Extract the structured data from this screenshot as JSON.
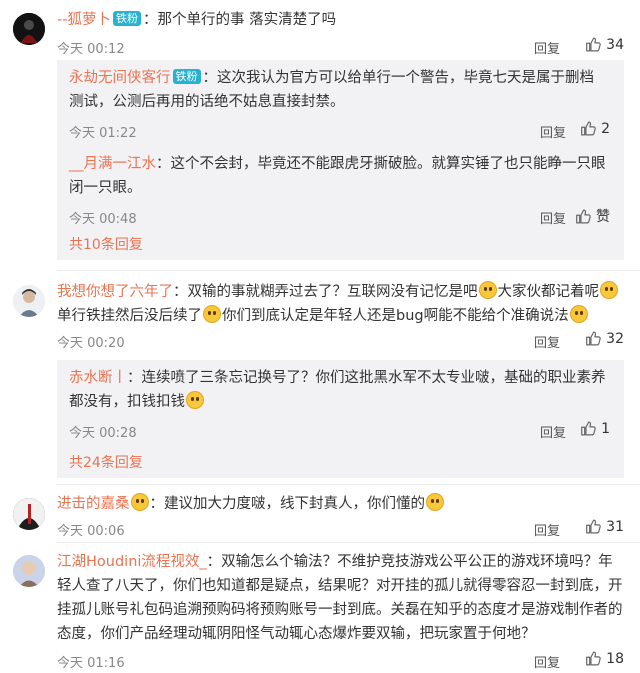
{
  "comments": [
    {
      "user": "--狐萝卜",
      "badge": "铁粉",
      "text": "：那个单行的事 落实清楚了吗",
      "time": "今天 00:12",
      "reply": "回复",
      "likes": "34",
      "replies": [
        {
          "user": "永劫无间侠客行",
          "badge": "铁粉",
          "text": "：这次我认为官方可以给单行一个警告，毕竟七天是属于删档测试，公测后再用的话绝不姑息直接封禁。",
          "time": "今天 01:22",
          "reply": "回复",
          "likes": "2"
        },
        {
          "user": "__月满一江水",
          "text": "：这个不会封，毕竟还不能跟虎牙撕破脸。就算实锤了也只能睁一只眼闭一只眼。",
          "time": "今天 00:48",
          "reply": "回复",
          "likes": "赞"
        }
      ],
      "more": "共10条回复"
    },
    {
      "user": "我想你想了六年了",
      "text1": "：双输的事就糊弄过去了？互联网没有记忆是吧",
      "text2": "大家伙都记着呢",
      "text3": "单行铁挂然后没后续了",
      "text4": "你们到底认定是年轻人还是bug啊能不能给个准确说法",
      "time": "今天 00:20",
      "reply": "回复",
      "likes": "32",
      "replies": [
        {
          "user": "赤水断丨",
          "text": "：连续喷了三条忘记换号了？你们这批黑水军不太专业啵，基础的职业素养都没有，扣钱扣钱",
          "time": "今天 00:28",
          "reply": "回复",
          "likes": "1"
        }
      ],
      "more": "共24条回复"
    },
    {
      "user": "进击的嘉桑",
      "text": "：建议加大力度啵，线下封真人，你们懂的",
      "time": "今天 00:06",
      "reply": "回复",
      "likes": "31"
    },
    {
      "user": "江湖Houdini流程视效_",
      "text": "：双输怎么个输法？不维护竞技游戏公平公正的游戏环境吗？年轻人查了八天了，你们也知道都是疑点，结果呢？对开挂的孤儿就得零容忍一封到底，开挂孤儿账号礼包码追溯预购码将预购账号一封到底。关磊在知乎的态度才是游戏制作者的态度，你们产品经理动辄阴阳怪气动辄心态爆炸要双输，把玩家置于何地？",
      "time": "今天 01:16",
      "reply": "回复",
      "likes": "18"
    }
  ],
  "colors": {
    "username": "#eb7350",
    "badge": "#29b2cf",
    "subbg": "#f2f2f5"
  }
}
